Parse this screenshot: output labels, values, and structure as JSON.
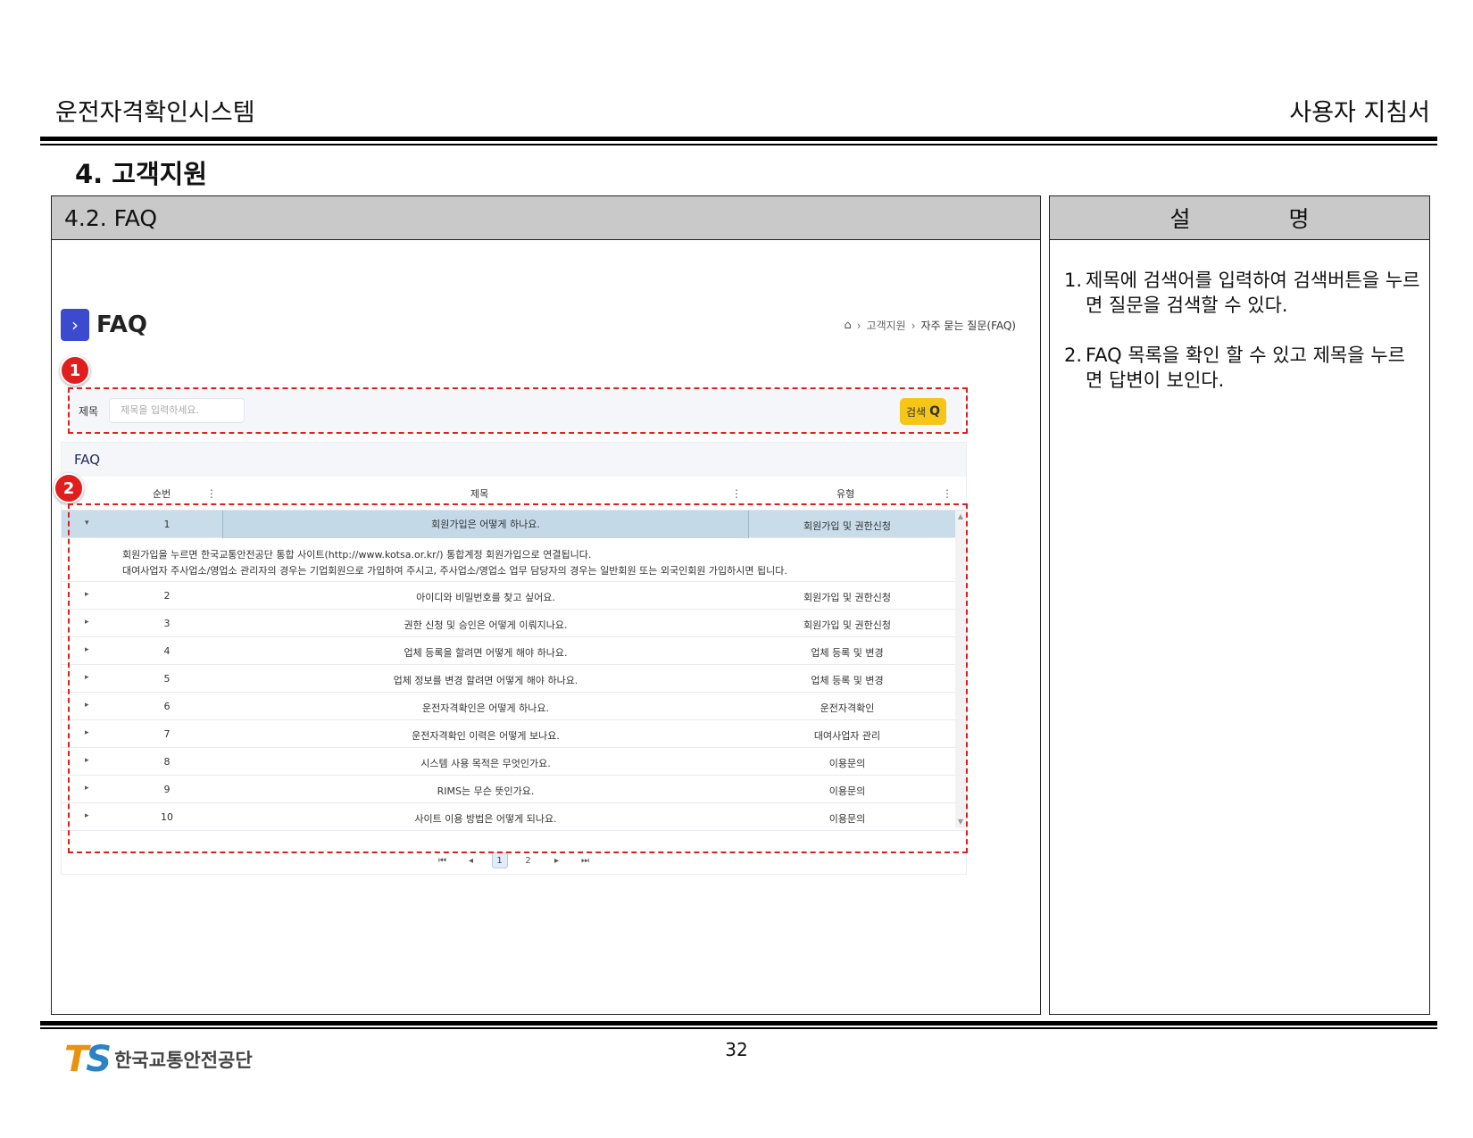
{
  "header": {
    "system_name": "운전자격확인시스템",
    "doc_type": "사용자 지침서"
  },
  "section": {
    "title": "4. 고객지원"
  },
  "left_panel": {
    "title": "4.2. FAQ"
  },
  "right_panel": {
    "heading_left": "설",
    "heading_right": "명",
    "items": [
      {
        "num": "1.",
        "text": "제목에 검색어를 입력하여 검색버튼을 누르면 질문을 검색할 수 있다."
      },
      {
        "num": "2.",
        "text": "FAQ 목록을 확인 할 수 있고 제목을 누르면 답변이 보인다."
      }
    ]
  },
  "screenshot": {
    "page_title": "FAQ",
    "breadcrumb": {
      "home_icon": "home-icon",
      "level1": "고객지원",
      "level2": "자주 묻는 질문(FAQ)",
      "separator": "›"
    },
    "search": {
      "label": "제목",
      "placeholder": "제목을 입력하세요.",
      "button_label": "검색",
      "button_icon": "Q"
    },
    "grid": {
      "title": "FAQ",
      "columns": {
        "num": "순번",
        "title": "제목",
        "type": "유형"
      },
      "expanded_answer_line1": "회원가입을 누르면 한국교통안전공단 통합 사이트(http://www.kotsa.or.kr/) 통합계정 회원가입으로 연결됩니다.",
      "expanded_answer_line2": "대여사업자 주사업소/영업소 관리자의 경우는 기업회원으로 가입하여 주시고, 주사업소/영업소 업무 담당자의 경우는 일반회원 또는 외국인회원 가입하시면 됩니다.",
      "rows": [
        {
          "num": "1",
          "title": "회원가입은 어떻게 하나요.",
          "type": "회원가입 및 권한신청"
        },
        {
          "num": "2",
          "title": "아이디와 비밀번호를 찾고 싶어요.",
          "type": "회원가입 및 권한신청"
        },
        {
          "num": "3",
          "title": "권한 신청 및 승인은 어떻게 이뤄지나요.",
          "type": "회원가입 및 권한신청"
        },
        {
          "num": "4",
          "title": "업체 등록을 할려면 어떻게 해야 하나요.",
          "type": "업체 등록 및 변경"
        },
        {
          "num": "5",
          "title": "업체 정보를 변경 할려면 어떻게 해야 하나요.",
          "type": "업체 등록 및 변경"
        },
        {
          "num": "6",
          "title": "운전자격확인은 어떻게 하나요.",
          "type": "운전자격확인"
        },
        {
          "num": "7",
          "title": "운전자격확인 이력은 어떻게 보나요.",
          "type": "대여사업자 관리"
        },
        {
          "num": "8",
          "title": "시스템 사용 목적은 무엇인가요.",
          "type": "이용문의"
        },
        {
          "num": "9",
          "title": "RIMS는 무슨 뜻인가요.",
          "type": "이용문의"
        },
        {
          "num": "10",
          "title": "사이트 이용 방법은 어떻게 되나요.",
          "type": "이용문의"
        }
      ],
      "pager": {
        "first": "⏮",
        "prev": "◂",
        "pages": [
          "1",
          "2"
        ],
        "next": "▸",
        "last": "⏭"
      }
    },
    "markers": [
      "1",
      "2"
    ]
  },
  "footer": {
    "page_number": "32",
    "logo_mark_t": "T",
    "logo_mark_s": "S",
    "logo_text": "한국교통안전공단"
  }
}
